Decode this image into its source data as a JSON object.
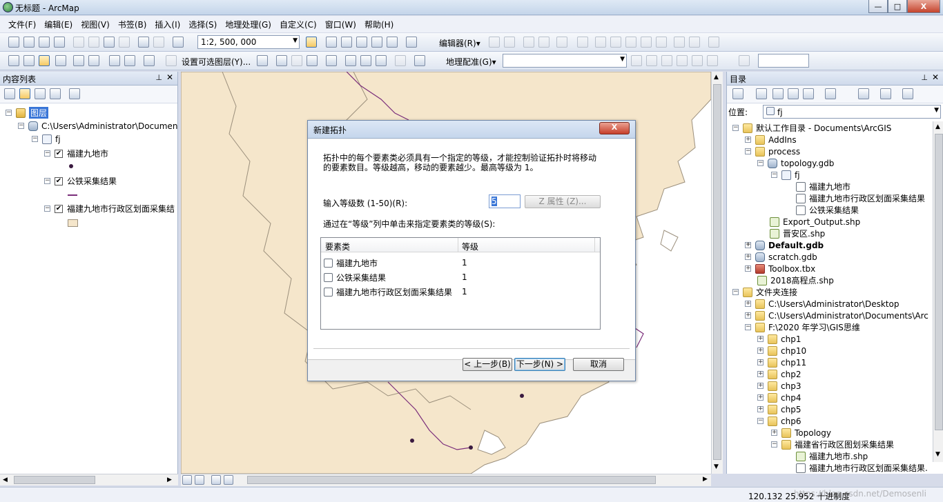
{
  "window": {
    "title": "无标题 - ArcMap",
    "minimize": "—",
    "maximize": "□",
    "close": "X"
  },
  "menu": [
    "文件(F)",
    "编辑(E)",
    "视图(V)",
    "书签(B)",
    "插入(I)",
    "选择(S)",
    "地理处理(G)",
    "自定义(C)",
    "窗口(W)",
    "帮助(H)"
  ],
  "toolbar1": {
    "scale": "1:2, 500, 000",
    "editor": "编辑器(R)▾"
  },
  "toolbar2": {
    "selectable_layers": "设置可选图层(Y)...",
    "georef": "地理配准(G)▾",
    "georef_layer": "",
    "text_box": ""
  },
  "toc": {
    "title": "内容列表",
    "layers_root": "图层",
    "path": "C:\\Users\\Administrator\\Documen",
    "dataset": "fj",
    "items": [
      {
        "label": "福建九地市",
        "checked": true
      },
      {
        "label": "公铁采集结果",
        "checked": true
      },
      {
        "label": "福建九地市行政区划面采集结",
        "checked": true
      }
    ]
  },
  "dialog": {
    "title": "新建拓扑",
    "close": "X",
    "desc1": "拓扑中的每个要素类必须具有一个指定的等级，才能控制验证拓扑时将移动",
    "desc2": "的要素数目。等级越高，移动的要素越少。最高等级为 1。",
    "rank_label": "输入等级数 (1-50)(R):",
    "rank_value": "5",
    "z_button": "Z 属性 (Z)...",
    "instruction": "通过在“等级”列中单击来指定要素类的等级(S):",
    "col_featureclass": "要素类",
    "col_rank": "等级",
    "rows": [
      {
        "name": "福建九地市",
        "rank": "1"
      },
      {
        "name": "公铁采集结果",
        "rank": "1"
      },
      {
        "name": "福建九地市行政区划面采集结果",
        "rank": "1"
      }
    ],
    "back": "< 上一步(B)",
    "next": "下一步(N) >",
    "cancel": "取消"
  },
  "catalog": {
    "title": "目录",
    "location_label": "位置:",
    "location_value": "fj",
    "items": [
      "默认工作目录 - Documents\\ArcGIS",
      "AddIns",
      "process",
      "topology.gdb",
      "fj",
      "福建九地市",
      "福建九地市行政区划面采集结果",
      "公铁采集结果",
      "Export_Output.shp",
      "晋安区.shp",
      "Default.gdb",
      "scratch.gdb",
      "Toolbox.tbx",
      "2018高程点.shp",
      "文件夹连接",
      "C:\\Users\\Administrator\\Desktop",
      "C:\\Users\\Administrator\\Documents\\Arc",
      "F:\\2020 年学习\\GIS思维",
      "chp1",
      "chp10",
      "chp11",
      "chp2",
      "chp3",
      "chp4",
      "chp5",
      "chp6",
      "Topology",
      "福建省行政区图划采集结果",
      "福建九地市.shp",
      "福建九地市行政区划面采集结果."
    ]
  },
  "status": {
    "coords": "120.132  25.952 十进制度",
    "watermark": "https://blog.csdn.net/Demosenli"
  },
  "colors": {
    "land": "#f5e6cb",
    "boundary": "#9b8f7c",
    "rail": "#7a2d7a"
  }
}
